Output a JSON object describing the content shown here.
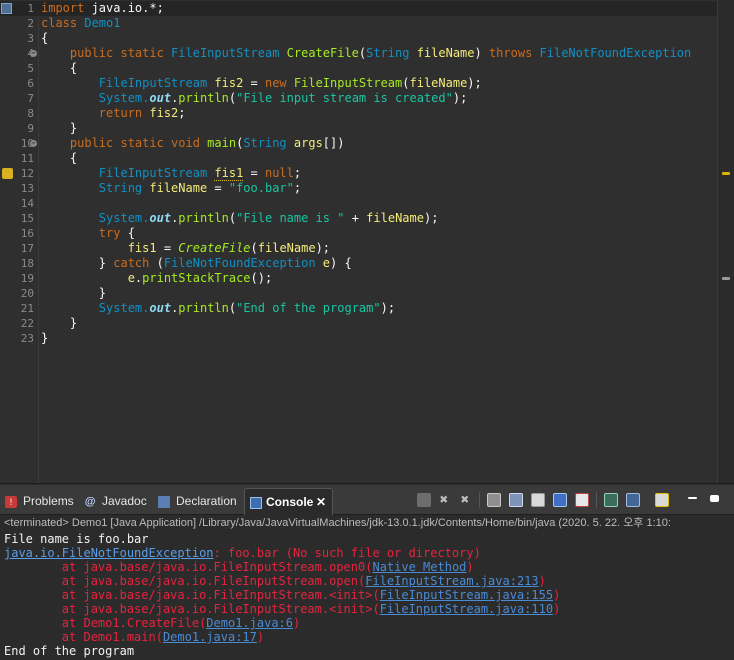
{
  "editor": {
    "lines": [
      {
        "n": "1",
        "tokens": [
          {
            "t": "import",
            "c": "kw"
          },
          {
            "t": " java.io.*;",
            "c": "tx"
          }
        ]
      },
      {
        "n": "2",
        "tokens": [
          {
            "t": "class",
            "c": "kw"
          },
          {
            "t": " Demo1",
            "c": "ty"
          }
        ]
      },
      {
        "n": "3",
        "tokens": [
          {
            "t": "{",
            "c": "tx"
          }
        ]
      },
      {
        "n": "4",
        "tokens": [
          {
            "t": "    public static ",
            "c": "kw"
          },
          {
            "t": "FileInputStream ",
            "c": "ty"
          },
          {
            "t": "CreateFile",
            "c": "fn"
          },
          {
            "t": "(",
            "c": "tx"
          },
          {
            "t": "String ",
            "c": "ty"
          },
          {
            "t": "fileName",
            "c": "vr"
          },
          {
            "t": ") ",
            "c": "tx"
          },
          {
            "t": "throws ",
            "c": "kw"
          },
          {
            "t": "FileNotFoundException",
            "c": "ty"
          }
        ]
      },
      {
        "n": "5",
        "tokens": [
          {
            "t": "    {",
            "c": "tx"
          }
        ]
      },
      {
        "n": "6",
        "tokens": [
          {
            "t": "        FileInputStream ",
            "c": "ty"
          },
          {
            "t": "fis2",
            "c": "vr"
          },
          {
            "t": " = ",
            "c": "tx"
          },
          {
            "t": "new ",
            "c": "kw"
          },
          {
            "t": "FileInputStream",
            "c": "fn"
          },
          {
            "t": "(",
            "c": "tx"
          },
          {
            "t": "fileName",
            "c": "vr"
          },
          {
            "t": ");",
            "c": "tx"
          }
        ]
      },
      {
        "n": "7",
        "tokens": [
          {
            "t": "        System.",
            "c": "ty"
          },
          {
            "t": "out",
            "c": "sf"
          },
          {
            "t": ".",
            "c": "tx"
          },
          {
            "t": "println",
            "c": "fn"
          },
          {
            "t": "(",
            "c": "tx"
          },
          {
            "t": "\"File input stream is created\"",
            "c": "st"
          },
          {
            "t": ");",
            "c": "tx"
          }
        ]
      },
      {
        "n": "8",
        "tokens": [
          {
            "t": "        return ",
            "c": "kw"
          },
          {
            "t": "fis2",
            "c": "vr"
          },
          {
            "t": ";",
            "c": "tx"
          }
        ]
      },
      {
        "n": "9",
        "tokens": [
          {
            "t": "    }",
            "c": "tx"
          }
        ]
      },
      {
        "n": "10",
        "tokens": [
          {
            "t": "    public static void ",
            "c": "kw"
          },
          {
            "t": "main",
            "c": "fn"
          },
          {
            "t": "(",
            "c": "tx"
          },
          {
            "t": "String ",
            "c": "ty"
          },
          {
            "t": "args",
            "c": "vr"
          },
          {
            "t": "[])",
            "c": "tx"
          }
        ]
      },
      {
        "n": "11",
        "tokens": [
          {
            "t": "    {",
            "c": "tx"
          }
        ]
      },
      {
        "n": "12",
        "tokens": [
          {
            "t": "        FileInputStream ",
            "c": "ty"
          },
          {
            "t": "fis1",
            "c": "vr warn-ul"
          },
          {
            "t": " = ",
            "c": "tx"
          },
          {
            "t": "null",
            "c": "kw"
          },
          {
            "t": ";",
            "c": "tx"
          }
        ]
      },
      {
        "n": "13",
        "tokens": [
          {
            "t": "        String ",
            "c": "ty"
          },
          {
            "t": "fileName",
            "c": "vr"
          },
          {
            "t": " = ",
            "c": "tx"
          },
          {
            "t": "\"foo.bar\"",
            "c": "st"
          },
          {
            "t": ";",
            "c": "tx"
          }
        ]
      },
      {
        "n": "14",
        "tokens": []
      },
      {
        "n": "15",
        "tokens": [
          {
            "t": "        System.",
            "c": "ty"
          },
          {
            "t": "out",
            "c": "sf"
          },
          {
            "t": ".",
            "c": "tx"
          },
          {
            "t": "println",
            "c": "fn"
          },
          {
            "t": "(",
            "c": "tx"
          },
          {
            "t": "\"File name is \"",
            "c": "st"
          },
          {
            "t": " + ",
            "c": "tx"
          },
          {
            "t": "fileName",
            "c": "vr"
          },
          {
            "t": ");",
            "c": "tx"
          }
        ]
      },
      {
        "n": "16",
        "tokens": [
          {
            "t": "        try ",
            "c": "kw"
          },
          {
            "t": "{",
            "c": "tx"
          }
        ]
      },
      {
        "n": "17",
        "tokens": [
          {
            "t": "            fis1",
            "c": "vr"
          },
          {
            "t": " = ",
            "c": "tx"
          },
          {
            "t": "CreateFile",
            "c": "sfn"
          },
          {
            "t": "(",
            "c": "tx"
          },
          {
            "t": "fileName",
            "c": "vr"
          },
          {
            "t": ");",
            "c": "tx"
          }
        ]
      },
      {
        "n": "18",
        "tokens": [
          {
            "t": "        } ",
            "c": "tx"
          },
          {
            "t": "catch ",
            "c": "kw"
          },
          {
            "t": "(",
            "c": "tx"
          },
          {
            "t": "FileNotFoundException ",
            "c": "ty"
          },
          {
            "t": "e",
            "c": "vr"
          },
          {
            "t": ") {",
            "c": "tx"
          }
        ]
      },
      {
        "n": "19",
        "tokens": [
          {
            "t": "            e",
            "c": "vr"
          },
          {
            "t": ".",
            "c": "tx"
          },
          {
            "t": "printStackTrace",
            "c": "fn"
          },
          {
            "t": "();",
            "c": "tx"
          }
        ]
      },
      {
        "n": "20",
        "tokens": [
          {
            "t": "        }",
            "c": "tx"
          }
        ]
      },
      {
        "n": "21",
        "tokens": [
          {
            "t": "        System.",
            "c": "ty"
          },
          {
            "t": "out",
            "c": "sf"
          },
          {
            "t": ".",
            "c": "tx"
          },
          {
            "t": "println",
            "c": "fn"
          },
          {
            "t": "(",
            "c": "tx"
          },
          {
            "t": "\"End of the program\"",
            "c": "st"
          },
          {
            "t": ");",
            "c": "tx"
          }
        ]
      },
      {
        "n": "22",
        "tokens": [
          {
            "t": "    }",
            "c": "tx"
          }
        ]
      },
      {
        "n": "23",
        "tokens": [
          {
            "t": "}",
            "c": "tx"
          }
        ]
      }
    ],
    "current_line": "1",
    "fold_lines": [
      "4",
      "10"
    ],
    "warning_line": "12",
    "bookmark_line": "1",
    "colors": {
      "background": "#2f2f2f",
      "keyword": "#cc6c1d",
      "type": "#1290c3",
      "method": "#a7ec21",
      "variable": "#f3ec79",
      "string": "#17c6a3",
      "static_field": "#8dd9f4"
    }
  },
  "views": {
    "tabs": [
      {
        "label": "Problems",
        "icon": "problems-icon",
        "active": false
      },
      {
        "label": "Javadoc",
        "icon": "javadoc-icon",
        "active": false
      },
      {
        "label": "Declaration",
        "icon": "declaration-icon",
        "active": false
      },
      {
        "label": "Console",
        "icon": "console-icon",
        "active": true
      }
    ],
    "close_glyph": "✕",
    "toolbar_icons": [
      "terminate-icon",
      "remove-launch-icon",
      "remove-all-terminated-icon",
      "scroll-lock-icon",
      "word-wrap-icon",
      "show-on-stdout-icon",
      "show-on-stderr-icon",
      "pin-console-icon",
      "display-selected-console-icon",
      "open-console-icon",
      "minimize-icon",
      "maximize-icon"
    ]
  },
  "console": {
    "status": "<terminated> Demo1 [Java Application] /Library/Java/JavaVirtualMachines/jdk-13.0.1.jdk/Contents/Home/bin/java (2020. 5. 22. 오후 1:10:",
    "lines": [
      {
        "segs": [
          {
            "t": "File name is foo.bar",
            "c": "out"
          }
        ]
      },
      {
        "segs": [
          {
            "t": "java.io.FileNotFoundException",
            "c": "lnk"
          },
          {
            "t": ": foo.bar (No such file or directory)",
            "c": "err"
          }
        ]
      },
      {
        "segs": [
          {
            "t": "\tat java.base/java.io.FileInputStream.open0(",
            "c": "err"
          },
          {
            "t": "Native Method",
            "c": "lnk2"
          },
          {
            "t": ")",
            "c": "err"
          }
        ]
      },
      {
        "segs": [
          {
            "t": "\tat java.base/java.io.FileInputStream.open(",
            "c": "err"
          },
          {
            "t": "FileInputStream.java:213",
            "c": "lnk2"
          },
          {
            "t": ")",
            "c": "err"
          }
        ]
      },
      {
        "segs": [
          {
            "t": "\tat java.base/java.io.FileInputStream.<init>(",
            "c": "err"
          },
          {
            "t": "FileInputStream.java:155",
            "c": "lnk2"
          },
          {
            "t": ")",
            "c": "err"
          }
        ]
      },
      {
        "segs": [
          {
            "t": "\tat java.base/java.io.FileInputStream.<init>(",
            "c": "err"
          },
          {
            "t": "FileInputStream.java:110",
            "c": "lnk2"
          },
          {
            "t": ")",
            "c": "err"
          }
        ]
      },
      {
        "segs": [
          {
            "t": "\tat Demo1.CreateFile(",
            "c": "err"
          },
          {
            "t": "Demo1.java:6",
            "c": "lnk2"
          },
          {
            "t": ")",
            "c": "err"
          }
        ]
      },
      {
        "segs": [
          {
            "t": "\tat Demo1.main(",
            "c": "err"
          },
          {
            "t": "Demo1.java:17",
            "c": "lnk2"
          },
          {
            "t": ")",
            "c": "err"
          }
        ]
      },
      {
        "segs": [
          {
            "t": "End of the program",
            "c": "out"
          }
        ]
      }
    ],
    "colors": {
      "stdout": "#f2f2f2",
      "stderr": "#e5243f",
      "link": "#5a9ee8"
    }
  }
}
